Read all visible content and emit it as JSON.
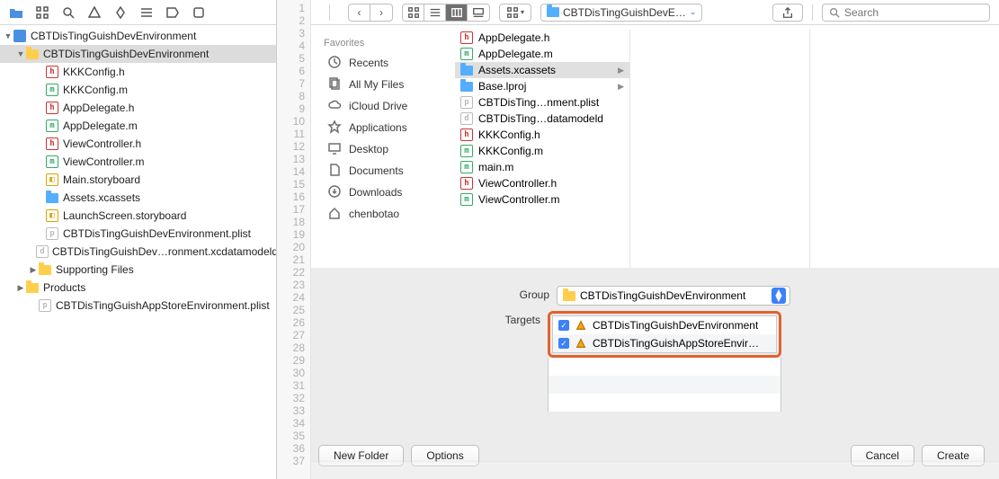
{
  "navigator": {
    "project": "CBTDisTingGuishDevEnvironment",
    "group": "CBTDisTingGuishDevEnvironment",
    "files": [
      {
        "name": "KKKConfig.h",
        "kind": "h"
      },
      {
        "name": "KKKConfig.m",
        "kind": "m"
      },
      {
        "name": "AppDelegate.h",
        "kind": "h"
      },
      {
        "name": "AppDelegate.m",
        "kind": "m"
      },
      {
        "name": "ViewController.h",
        "kind": "h"
      },
      {
        "name": "ViewController.m",
        "kind": "m"
      },
      {
        "name": "Main.storyboard",
        "kind": "sb"
      },
      {
        "name": "Assets.xcassets",
        "kind": "folder-blue"
      },
      {
        "name": "LaunchScreen.storyboard",
        "kind": "sb"
      },
      {
        "name": "CBTDisTingGuishDevEnvironment.plist",
        "kind": "plist"
      },
      {
        "name": "CBTDisTingGuishDev…ronment.xcdatamodeld",
        "kind": "model"
      }
    ],
    "supporting": "Supporting Files",
    "products": "Products",
    "extra_plist": "CBTDisTingGuishAppStoreEnvironment.plist"
  },
  "gutter_start": 1,
  "gutter_end": 37,
  "toolbar": {
    "path_label": "CBTDisTingGuishDevE…",
    "search_placeholder": "Search"
  },
  "favorites": {
    "title": "Favorites",
    "items": [
      "Recents",
      "All My Files",
      "iCloud Drive",
      "Applications",
      "Desktop",
      "Documents",
      "Downloads",
      "chenbotao"
    ]
  },
  "column1": [
    {
      "name": "AppDelegate.h",
      "kind": "h"
    },
    {
      "name": "AppDelegate.m",
      "kind": "m"
    },
    {
      "name": "Assets.xcassets",
      "kind": "folder-blue",
      "hasChild": true,
      "sel": true
    },
    {
      "name": "Base.lproj",
      "kind": "folder-blue",
      "hasChild": true
    },
    {
      "name": "CBTDisTing…nment.plist",
      "kind": "plist"
    },
    {
      "name": "CBTDisTing…datamodeld",
      "kind": "model"
    },
    {
      "name": "KKKConfig.h",
      "kind": "h"
    },
    {
      "name": "KKKConfig.m",
      "kind": "m"
    },
    {
      "name": "main.m",
      "kind": "m"
    },
    {
      "name": "ViewController.h",
      "kind": "h"
    },
    {
      "name": "ViewController.m",
      "kind": "m"
    }
  ],
  "sheet": {
    "group_label": "Group",
    "group_value": "CBTDisTingGuishDevEnvironment",
    "targets_label": "Targets",
    "targets": [
      "CBTDisTingGuishDevEnvironment",
      "CBTDisTingGuishAppStoreEnvir…"
    ],
    "new_folder": "New Folder",
    "options": "Options",
    "cancel": "Cancel",
    "create": "Create"
  }
}
